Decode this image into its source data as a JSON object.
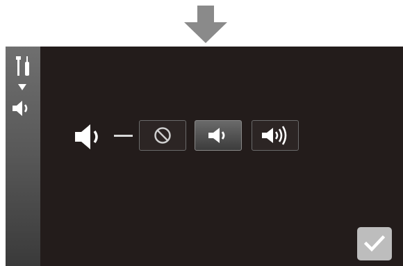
{
  "screen": {
    "sidebar": {
      "icons": [
        "tools-icon",
        "caret-down-icon",
        "speaker-icon"
      ]
    },
    "current_setting": {
      "icon": "speaker-low-icon"
    },
    "volume_options": [
      {
        "id": "mute",
        "icon": "mute-icon",
        "selected": false
      },
      {
        "id": "low",
        "icon": "speaker-low-icon",
        "selected": true
      },
      {
        "id": "high",
        "icon": "speaker-high-icon",
        "selected": false
      }
    ],
    "confirm": {
      "icon": "check-icon"
    }
  },
  "colors": {
    "background": "#231c1b",
    "sidebar": "#5a5a5a",
    "selected_option": "#6a6a6a",
    "confirm_button": "#bdbdbd",
    "icon": "#ffffff"
  }
}
